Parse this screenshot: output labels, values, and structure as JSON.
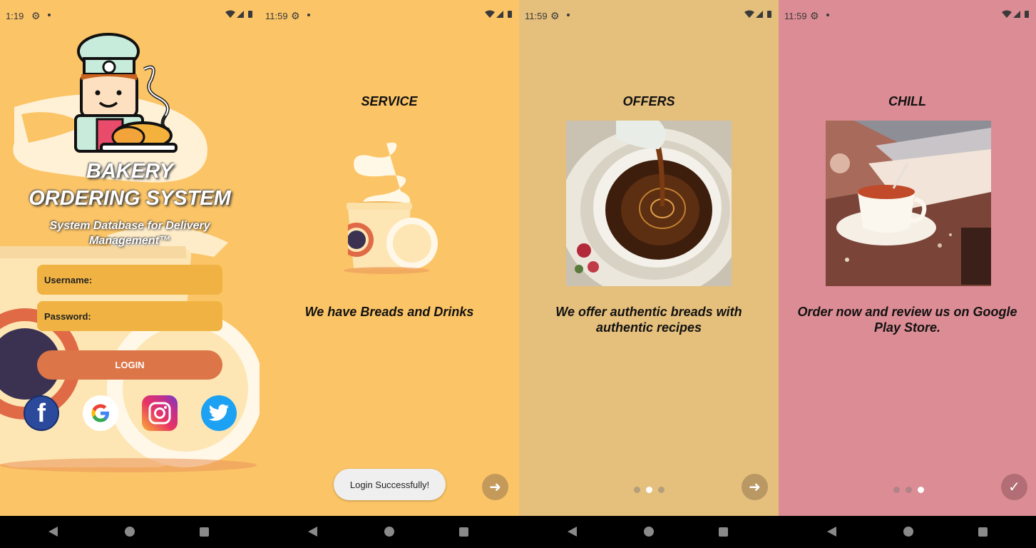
{
  "status_bars": [
    {
      "time": "1:19"
    },
    {
      "time": "11:59"
    },
    {
      "time": "11:59"
    },
    {
      "time": "11:59"
    }
  ],
  "login": {
    "title_line1": "BAKERY",
    "title_line2": "ORDERING SYSTEM",
    "subtitle": "System Database for Delivery Management™",
    "username_placeholder": "Username:",
    "password_placeholder": "Password:",
    "login_label": "LOGIN",
    "social": [
      "facebook-icon",
      "google-icon",
      "instagram-icon",
      "twitter-icon"
    ]
  },
  "slides": [
    {
      "title": "SERVICE",
      "description": "We have Breads and Drinks"
    },
    {
      "title": "OFFERS",
      "description": "We offer authentic breads with authentic recipes"
    },
    {
      "title": "CHILL",
      "description": "Order now and review us on Google Play Store."
    }
  ],
  "toast": "Login Successfully!",
  "colors": {
    "login_bg": "#fbc466",
    "service_bg": "#fbc466",
    "offers_bg": "#e5bf7c",
    "chill_bg": "#dc8c94",
    "field": "#f0b343",
    "login_button": "#dc7548"
  },
  "icons": {
    "next": "arrow-right-icon",
    "done": "checkmark-icon"
  }
}
